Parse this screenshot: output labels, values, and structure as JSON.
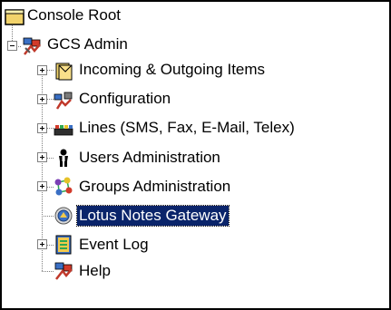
{
  "tree": {
    "root": {
      "label": "Console Root",
      "icon": "folder-icon"
    },
    "gcs_admin": {
      "label": "GCS Admin",
      "icon": "gcs-admin-icon",
      "expanded": true
    },
    "children": [
      {
        "label": "Incoming & Outgoing Items",
        "icon": "envelopes-icon",
        "expandable": true
      },
      {
        "label": "Configuration",
        "icon": "configuration-icon",
        "expandable": true
      },
      {
        "label": "Lines (SMS, Fax, E-Mail, Telex)",
        "icon": "lines-icon",
        "expandable": true
      },
      {
        "label": "Users Administration",
        "icon": "user-icon",
        "expandable": true
      },
      {
        "label": "Groups Administration",
        "icon": "groups-icon",
        "expandable": true
      },
      {
        "label": "Lotus Notes Gateway",
        "icon": "lotus-notes-icon",
        "expandable": false,
        "selected": true
      },
      {
        "label": "Event Log",
        "icon": "event-log-icon",
        "expandable": true
      },
      {
        "label": "Help",
        "icon": "help-icon",
        "expandable": false
      }
    ]
  },
  "colors": {
    "selection": "#0a246a",
    "selection_text": "#ffffff",
    "tree_lines": "#808080"
  }
}
